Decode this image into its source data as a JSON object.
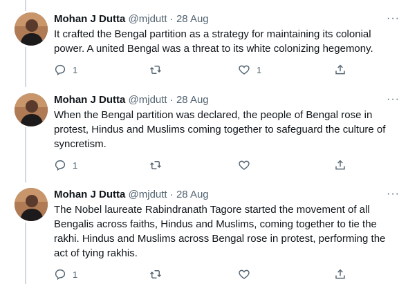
{
  "tweets": [
    {
      "author_name": "Mohan J Dutta",
      "handle": "@mjdutt",
      "separator": "·",
      "date": "28 Aug",
      "text": "It crafted the Bengal partition as a strategy for maintaining its colonial power. A united Bengal was a threat to its white colonizing hegemony.",
      "reply_count": "1",
      "retweet_count": "",
      "like_count": "1"
    },
    {
      "author_name": "Mohan J Dutta",
      "handle": "@mjdutt",
      "separator": "·",
      "date": "28 Aug",
      "text": "When the Bengal partition was declared, the people of Bengal rose in protest, Hindus and Muslims coming together to safeguard the culture of syncretism.",
      "reply_count": "1",
      "retweet_count": "",
      "like_count": ""
    },
    {
      "author_name": "Mohan J Dutta",
      "handle": "@mjdutt",
      "separator": "·",
      "date": "28 Aug",
      "text": "The Nobel laureate Rabindranath Tagore started the movement of all Bengalis across faiths, Hindus and Muslims, coming together to tie the rakhi. Hindus and Muslims across Bengal rose in protest, performing the act of tying rakhis.",
      "reply_count": "1",
      "retweet_count": "",
      "like_count": ""
    }
  ],
  "icons": {
    "more": "more-icon",
    "reply": "reply-icon",
    "retweet": "retweet-icon",
    "like": "like-icon",
    "share": "share-icon"
  },
  "colors": {
    "text": "#0f1419",
    "secondary": "#536471",
    "thread_line": "#cfd9de"
  }
}
